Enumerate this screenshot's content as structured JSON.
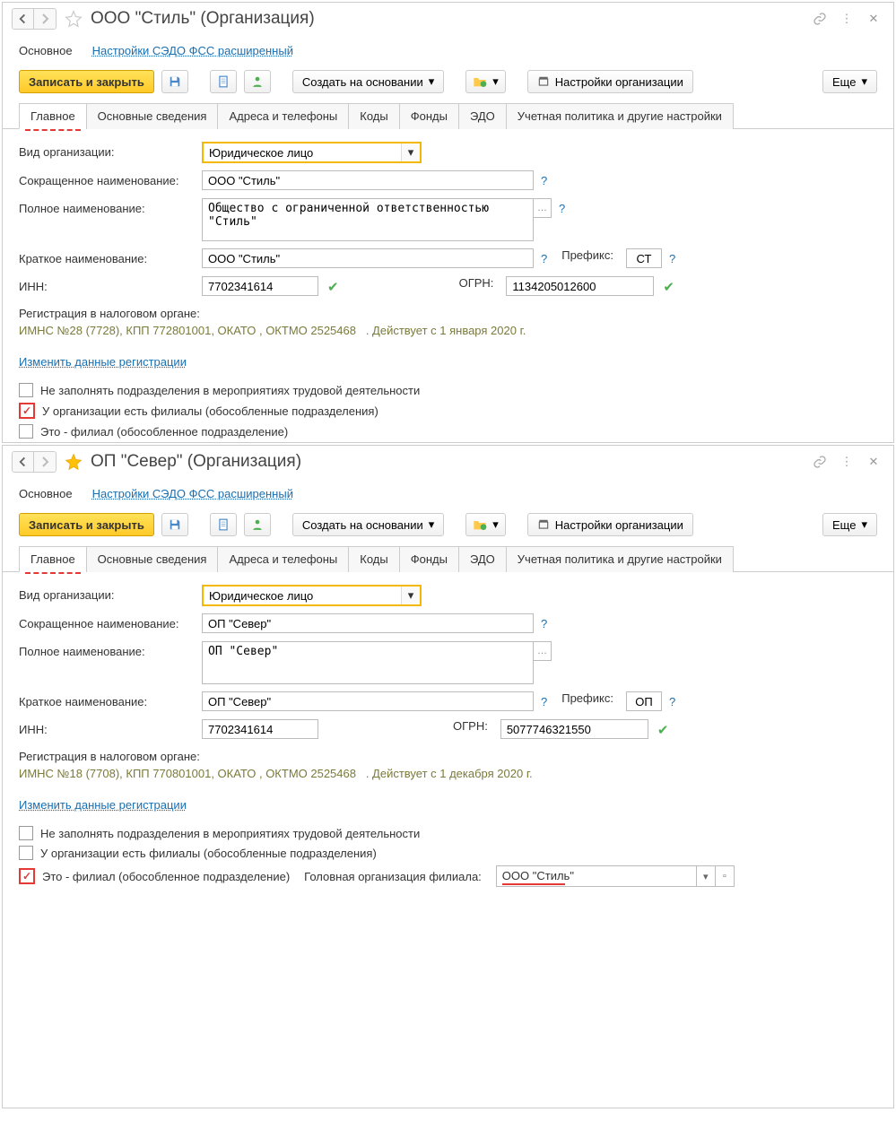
{
  "win1": {
    "title": "ООО \"Стиль\" (Организация)",
    "starred": false,
    "subtabs": {
      "main": "Основное",
      "sedo": "Настройки СЭДО ФСС расширенный"
    },
    "toolbar": {
      "save_close": "Записать и закрыть",
      "create_based": "Создать на основании",
      "org_settings": "Настройки организации",
      "more": "Еще"
    },
    "tabs": [
      "Главное",
      "Основные сведения",
      "Адреса и телефоны",
      "Коды",
      "Фонды",
      "ЭДО",
      "Учетная политика и другие настройки"
    ],
    "labels": {
      "org_type": "Вид организации:",
      "short_name": "Сокращенное наименование:",
      "full_name": "Полное наименование:",
      "brief_name": "Краткое наименование:",
      "prefix": "Префикс:",
      "inn": "ИНН:",
      "ogrn": "ОГРН:",
      "tax_reg": "Регистрация в налоговом органе:",
      "change_reg": "Изменить данные регистрации",
      "chk1": "Не заполнять подразделения в мероприятиях трудовой деятельности",
      "chk2": "У организации есть филиалы (обособленные подразделения)",
      "chk3": "Это - филиал (обособленное подразделение)"
    },
    "values": {
      "org_type": "Юридическое лицо",
      "short_name": "ООО \"Стиль\"",
      "full_name": "Общество с ограниченной ответственностью \"Стиль\"",
      "brief_name": "ООО \"Стиль\"",
      "prefix": "СТ",
      "inn": "7702341614",
      "ogrn": "1134205012600",
      "tax_line": "ИМНС №28 (7728), КПП 772801001, ОКАТО , ОКТМО 2525468",
      "tax_valid": ". Действует с 1 января 2020 г."
    }
  },
  "win2": {
    "title": "ОП \"Север\" (Организация)",
    "starred": true,
    "subtabs": {
      "main": "Основное",
      "sedo": "Настройки СЭДО ФСС расширенный"
    },
    "toolbar": {
      "save_close": "Записать и закрыть",
      "create_based": "Создать на основании",
      "org_settings": "Настройки организации",
      "more": "Еще"
    },
    "tabs": [
      "Главное",
      "Основные сведения",
      "Адреса и телефоны",
      "Коды",
      "Фонды",
      "ЭДО",
      "Учетная политика и другие настройки"
    ],
    "labels": {
      "org_type": "Вид организации:",
      "short_name": "Сокращенное наименование:",
      "full_name": "Полное наименование:",
      "brief_name": "Краткое наименование:",
      "prefix": "Префикс:",
      "inn": "ИНН:",
      "ogrn": "ОГРН:",
      "tax_reg": "Регистрация в налоговом органе:",
      "change_reg": "Изменить данные регистрации",
      "chk1": "Не заполнять подразделения в мероприятиях трудовой деятельности",
      "chk2": "У организации есть филиалы (обособленные подразделения)",
      "chk3": "Это - филиал (обособленное подразделение)",
      "parent": "Головная организация филиала:"
    },
    "values": {
      "org_type": "Юридическое лицо",
      "short_name": "ОП \"Север\"",
      "full_name": "ОП \"Север\"",
      "brief_name": "ОП \"Север\"",
      "prefix": "ОП",
      "inn": "7702341614",
      "ogrn": "5077746321550",
      "tax_line": "ИМНС №18 (7708), КПП 770801001, ОКАТО , ОКТМО 2525468",
      "tax_valid": ". Действует с 1 декабря 2020 г.",
      "parent_org": "ООО \"Стиль\""
    }
  }
}
